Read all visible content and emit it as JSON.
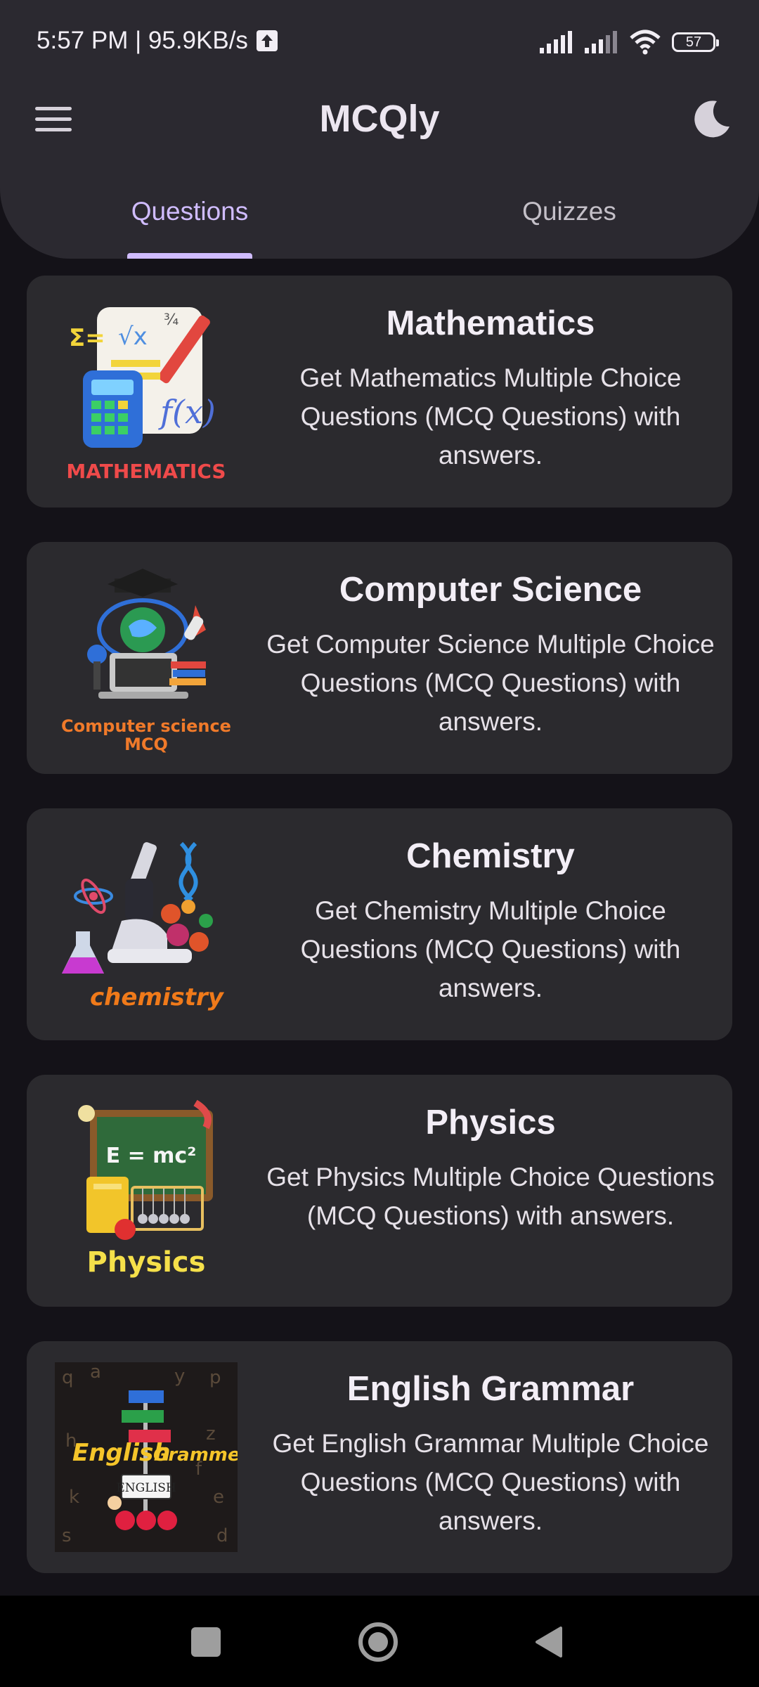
{
  "status_bar": {
    "time_speed": "5:57 PM | 95.9KB/s",
    "battery_level": "57"
  },
  "top_bar": {
    "title": "MCQly",
    "menu_icon": "menu-icon",
    "theme_icon": "moon-icon"
  },
  "tabs": [
    {
      "label": "Questions",
      "active": true
    },
    {
      "label": "Quizzes",
      "active": false
    }
  ],
  "cards": [
    {
      "title": "Mathematics",
      "description": "Get Mathematics Multiple Choice Questions (MCQ Questions) with answers.",
      "image_label": "MATHEMATICS"
    },
    {
      "title": "Computer Science",
      "description": "Get Computer Science Multiple Choice Questions (MCQ Questions) with answers.",
      "image_label": "Computer science MCQ"
    },
    {
      "title": "Chemistry",
      "description": "Get Chemistry Multiple Choice Questions (MCQ Questions) with answers.",
      "image_label": "chemistry"
    },
    {
      "title": "Physics",
      "description": "Get Physics Multiple Choice Questions (MCQ Questions) with answers.",
      "image_label": "Physics"
    },
    {
      "title": "English Grammar",
      "description": "Get English Grammar Multiple Choice Questions (MCQ Questions) with answers.",
      "image_label": "English Grammer"
    }
  ],
  "colors": {
    "background": "#141218",
    "header": "#2b2930",
    "card": "#2b2a2e",
    "accent": "#d0bcff"
  }
}
